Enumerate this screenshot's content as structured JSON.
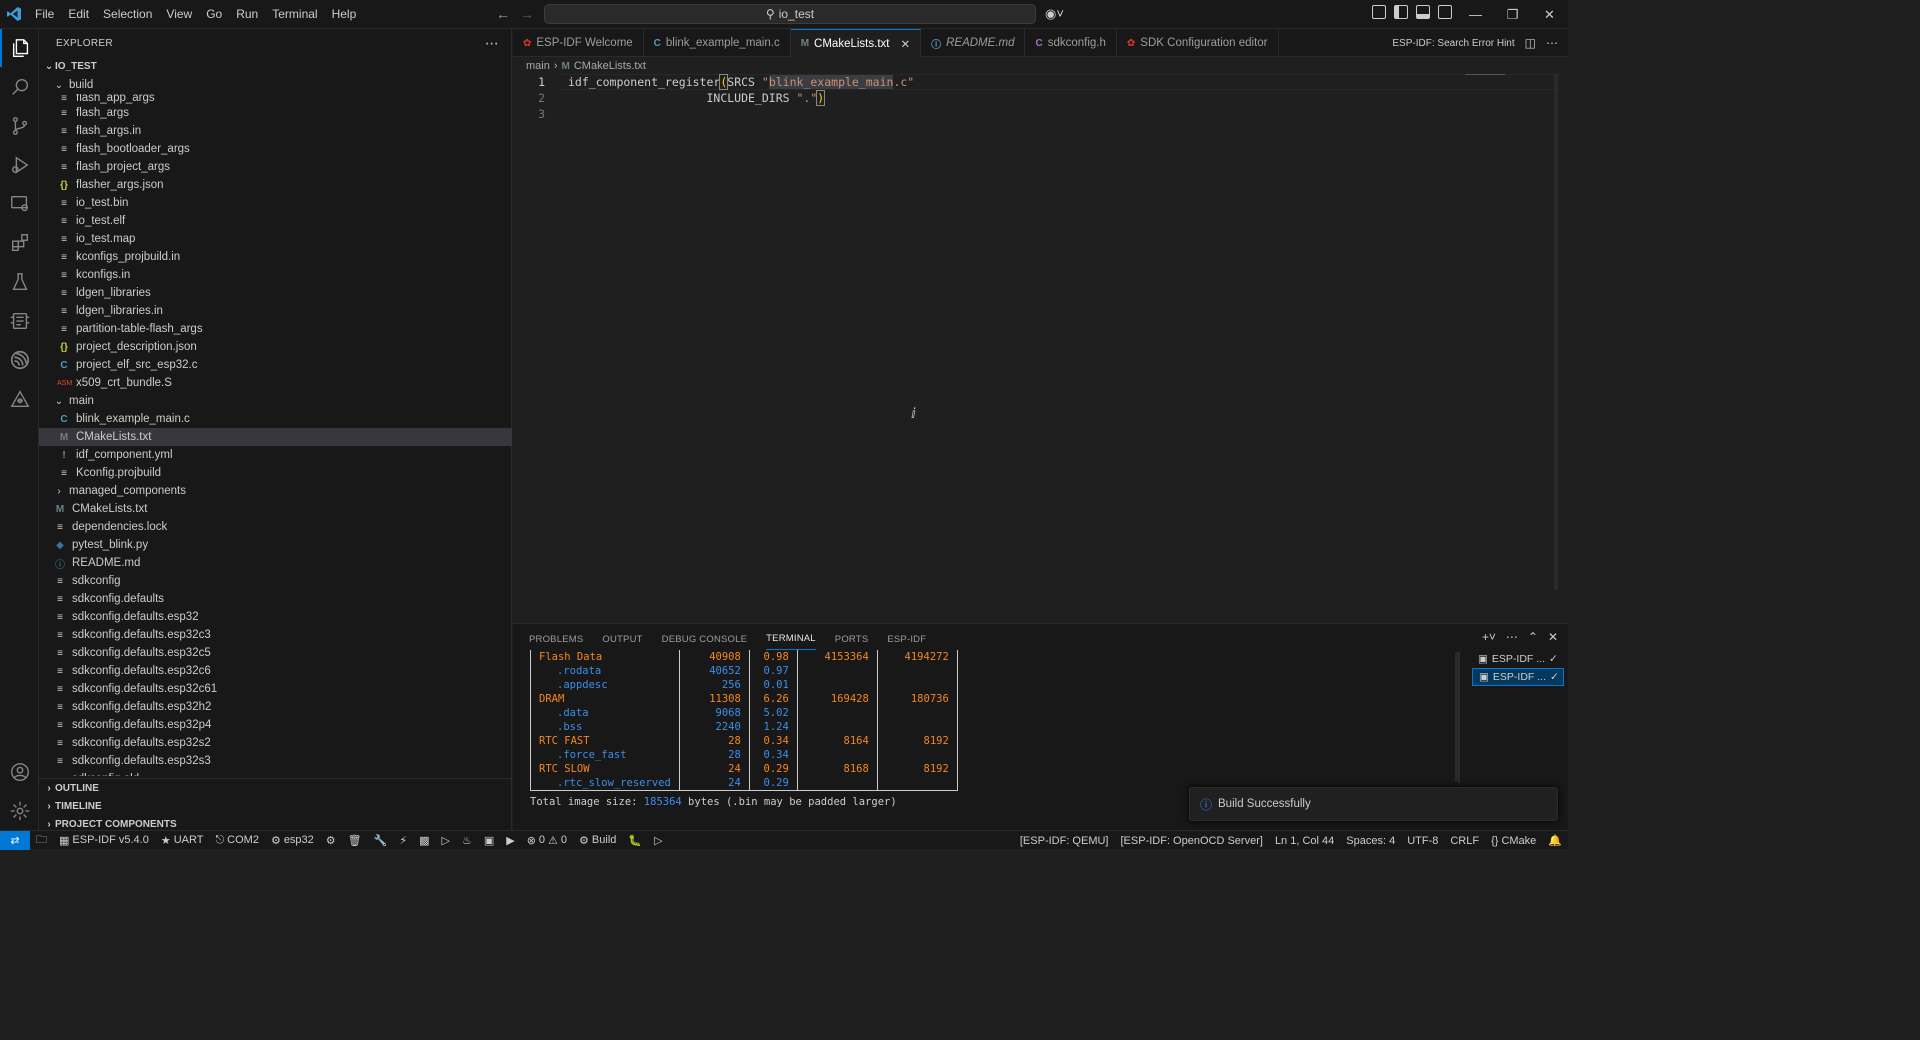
{
  "titlebar": {
    "menu": [
      "File",
      "Edit",
      "Selection",
      "View",
      "Go",
      "Run",
      "Terminal",
      "Help"
    ],
    "search_text": "io_test"
  },
  "explorer": {
    "header": "EXPLORER",
    "project": "IO_TEST",
    "tree": [
      {
        "label": "build",
        "type": "folder",
        "depth": 1,
        "icon": "chevron-down"
      },
      {
        "label": "flash_app_args",
        "type": "lines",
        "depth": 2
      },
      {
        "label": "flash_args",
        "type": "lines",
        "depth": 2
      },
      {
        "label": "flash_args.in",
        "type": "lines",
        "depth": 2
      },
      {
        "label": "flash_bootloader_args",
        "type": "lines",
        "depth": 2
      },
      {
        "label": "flash_project_args",
        "type": "lines",
        "depth": 2
      },
      {
        "label": "flasher_args.json",
        "type": "json",
        "depth": 2
      },
      {
        "label": "io_test.bin",
        "type": "lines",
        "depth": 2
      },
      {
        "label": "io_test.elf",
        "type": "lines",
        "depth": 2
      },
      {
        "label": "io_test.map",
        "type": "lines",
        "depth": 2
      },
      {
        "label": "kconfigs_projbuild.in",
        "type": "lines",
        "depth": 2
      },
      {
        "label": "kconfigs.in",
        "type": "lines",
        "depth": 2
      },
      {
        "label": "ldgen_libraries",
        "type": "lines",
        "depth": 2
      },
      {
        "label": "ldgen_libraries.in",
        "type": "lines",
        "depth": 2
      },
      {
        "label": "partition-table-flash_args",
        "type": "lines",
        "depth": 2
      },
      {
        "label": "project_description.json",
        "type": "json",
        "depth": 2
      },
      {
        "label": "project_elf_src_esp32.c",
        "type": "c",
        "depth": 2
      },
      {
        "label": "x509_crt_bundle.S",
        "type": "asm",
        "depth": 2
      },
      {
        "label": "main",
        "type": "folder",
        "depth": 1,
        "icon": "chevron-down"
      },
      {
        "label": "blink_example_main.c",
        "type": "c",
        "depth": 2
      },
      {
        "label": "CMakeLists.txt",
        "type": "m",
        "depth": 2,
        "selected": true
      },
      {
        "label": "idf_component.yml",
        "type": "yml",
        "depth": 2
      },
      {
        "label": "Kconfig.projbuild",
        "type": "lines",
        "depth": 2
      },
      {
        "label": "managed_components",
        "type": "folder",
        "depth": 1,
        "icon": "chevron-right"
      },
      {
        "label": "CMakeLists.txt",
        "type": "m",
        "depth": 1
      },
      {
        "label": "dependencies.lock",
        "type": "lines",
        "depth": 1
      },
      {
        "label": "pytest_blink.py",
        "type": "py",
        "depth": 1
      },
      {
        "label": "README.md",
        "type": "info",
        "depth": 1
      },
      {
        "label": "sdkconfig",
        "type": "lines",
        "depth": 1
      },
      {
        "label": "sdkconfig.defaults",
        "type": "lines",
        "depth": 1
      },
      {
        "label": "sdkconfig.defaults.esp32",
        "type": "lines",
        "depth": 1
      },
      {
        "label": "sdkconfig.defaults.esp32c3",
        "type": "lines",
        "depth": 1
      },
      {
        "label": "sdkconfig.defaults.esp32c5",
        "type": "lines",
        "depth": 1
      },
      {
        "label": "sdkconfig.defaults.esp32c6",
        "type": "lines",
        "depth": 1
      },
      {
        "label": "sdkconfig.defaults.esp32c61",
        "type": "lines",
        "depth": 1
      },
      {
        "label": "sdkconfig.defaults.esp32h2",
        "type": "lines",
        "depth": 1
      },
      {
        "label": "sdkconfig.defaults.esp32p4",
        "type": "lines",
        "depth": 1
      },
      {
        "label": "sdkconfig.defaults.esp32s2",
        "type": "lines",
        "depth": 1
      },
      {
        "label": "sdkconfig.defaults.esp32s3",
        "type": "lines",
        "depth": 1
      },
      {
        "label": "sdkconfig.old",
        "type": "lines",
        "depth": 1
      }
    ],
    "sections": [
      "OUTLINE",
      "TIMELINE",
      "PROJECT COMPONENTS"
    ]
  },
  "tabs": [
    {
      "label": "ESP-IDF Welcome",
      "icon": "espressif",
      "active": false
    },
    {
      "label": "blink_example_main.c",
      "icon": "c",
      "active": false
    },
    {
      "label": "CMakeLists.txt",
      "icon": "m",
      "active": true
    },
    {
      "label": "README.md",
      "icon": "info",
      "active": false,
      "italic": true
    },
    {
      "label": "sdkconfig.h",
      "icon": "c",
      "active": false
    },
    {
      "label": "SDK Configuration editor",
      "icon": "espressif",
      "active": false
    }
  ],
  "tabs_right": {
    "hint": "ESP-IDF: Search Error Hint"
  },
  "breadcrumb": {
    "folder": "main",
    "file": "CMakeLists.txt"
  },
  "editor": {
    "line_numbers": [
      "1",
      "2",
      "3"
    ],
    "line1_a": "idf_component_register",
    "line1_b": "(",
    "line1_c": "SRCS ",
    "line1_d": "\"",
    "line1_e": "blink_example_main",
    "line1_f": ".c\"",
    "line2_a": "                    INCLUDE_DIRS ",
    "line2_b": "\".\"",
    "line2_c": ")"
  },
  "panel": {
    "tabs": [
      "PROBLEMS",
      "OUTPUT",
      "DEBUG CONSOLE",
      "TERMINAL",
      "PORTS",
      "ESP-IDF"
    ],
    "active_tab": "TERMINAL",
    "table": [
      {
        "name": "Flash Data",
        "indent": false,
        "color": "orange",
        "size": "40908",
        "pct": "0.98",
        "remain": "4153364",
        "total": "4194272"
      },
      {
        "name": ".rodata",
        "indent": true,
        "color": "blue",
        "size": "40652",
        "pct": "0.97",
        "remain": "",
        "total": ""
      },
      {
        "name": ".appdesc",
        "indent": true,
        "color": "blue",
        "size": "256",
        "pct": "0.01",
        "remain": "",
        "total": ""
      },
      {
        "name": "DRAM",
        "indent": false,
        "color": "orange",
        "size": "11308",
        "pct": "6.26",
        "remain": "169428",
        "total": "180736"
      },
      {
        "name": ".data",
        "indent": true,
        "color": "blue",
        "size": "9068",
        "pct": "5.02",
        "remain": "",
        "total": ""
      },
      {
        "name": ".bss",
        "indent": true,
        "color": "blue",
        "size": "2240",
        "pct": "1.24",
        "remain": "",
        "total": ""
      },
      {
        "name": "RTC FAST",
        "indent": false,
        "color": "orange",
        "size": "28",
        "pct": "0.34",
        "remain": "8164",
        "total": "8192"
      },
      {
        "name": ".force_fast",
        "indent": true,
        "color": "blue",
        "size": "28",
        "pct": "0.34",
        "remain": "",
        "total": ""
      },
      {
        "name": "RTC SLOW",
        "indent": false,
        "color": "orange",
        "size": "24",
        "pct": "0.29",
        "remain": "8168",
        "total": "8192"
      },
      {
        "name": ".rtc_slow_reserved",
        "indent": true,
        "color": "blue",
        "size": "24",
        "pct": "0.29",
        "remain": "",
        "total": ""
      }
    ],
    "total_prefix": "Total image size: ",
    "total_value": "185364",
    "total_suffix": " bytes (.bin may be padded larger)",
    "terminals": [
      "ESP-IDF ...",
      "ESP-IDF ..."
    ]
  },
  "notification": {
    "text": "Build Successfully"
  },
  "statusbar": {
    "left": {
      "idf_version": "ESP-IDF v5.4.0",
      "flash_method": "UART",
      "port": "COM2",
      "target": "esp32",
      "problems_errors": "0",
      "problems_warnings": "0",
      "build": "Build"
    },
    "right": {
      "qemu": "[ESP-IDF: QEMU]",
      "openocd": "[ESP-IDF: OpenOCD Server]",
      "position": "Ln 1, Col 44",
      "spaces": "Spaces: 4",
      "encoding": "UTF-8",
      "eol": "CRLF",
      "language": "CMake"
    }
  },
  "colors": {
    "accent": "#0078d4",
    "orange": "#f5871f",
    "blue": "#3b8eea",
    "string": "#ce9178"
  }
}
